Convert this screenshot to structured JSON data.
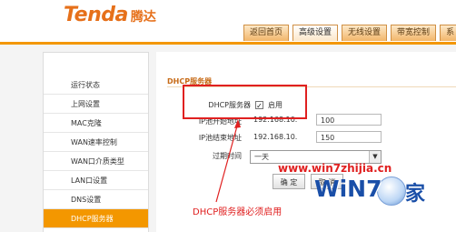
{
  "header": {
    "logo_text": "Tenda",
    "logo_cn": "腾达",
    "tabs": [
      {
        "label": "返回首页",
        "active": false
      },
      {
        "label": "高级设置",
        "active": true
      },
      {
        "label": "无线设置",
        "active": false
      },
      {
        "label": "带宽控制",
        "active": false
      },
      {
        "label": "系",
        "active": false
      }
    ]
  },
  "sidebar": {
    "items": [
      {
        "label": "运行状态",
        "active": false
      },
      {
        "label": "上网设置",
        "active": false
      },
      {
        "label": "MAC克隆",
        "active": false
      },
      {
        "label": "WAN速率控制",
        "active": false
      },
      {
        "label": "WAN口介质类型",
        "active": false
      },
      {
        "label": "LAN口设置",
        "active": false
      },
      {
        "label": "DNS设置",
        "active": false
      },
      {
        "label": "DHCP服务器",
        "active": true
      }
    ]
  },
  "main": {
    "section_title": "DHCP服务器",
    "dhcp_label": "DHCP服务器",
    "dhcp_enable_label": "启用",
    "dhcp_enabled": true,
    "start_ip_label": "IP池开始地址",
    "start_ip_prefix": "192.168.10.",
    "start_ip_suffix": "100",
    "end_ip_label": "IP池结束地址",
    "end_ip_prefix": "192.168.10.",
    "end_ip_suffix": "150",
    "lease_label": "过期时间",
    "lease_value": "一天",
    "ok_button": "确 定",
    "cancel_button": "取 消"
  },
  "annotation": {
    "text": "DHCP服务器必须启用",
    "color": "#e02020"
  },
  "watermark": {
    "url": "www.win7zhijia.cn",
    "brand": "WiN7",
    "brand_cn": "家"
  },
  "colors": {
    "accent": "#f39700",
    "highlight": "#e02020"
  }
}
